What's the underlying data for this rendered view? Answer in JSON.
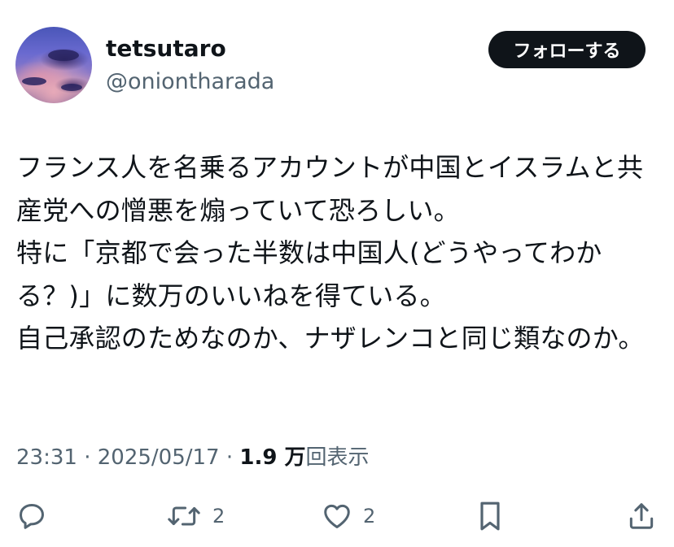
{
  "user": {
    "display_name": "tetsutaro",
    "handle": "@oniontharada"
  },
  "follow_button": {
    "label": "フォローする"
  },
  "tweet": {
    "text": "フランス人を名乗るアカウントが中国とイスラムと共産党への憎悪を煽っていて恐ろしい。\n特に「京都で会った半数は中国人(どうやってわかる？)」に数万のいいねを得ている。\n自己承認のためなのか、ナザレンコと同じ類なのか。"
  },
  "meta": {
    "time": "23:31",
    "separator": "·",
    "date": "2025/05/17",
    "views_count": "1.9 万",
    "views_label": "回表示"
  },
  "actions": {
    "reply": {
      "icon": "reply-icon",
      "count": ""
    },
    "retweet": {
      "icon": "retweet-icon",
      "count": "2"
    },
    "like": {
      "icon": "heart-icon",
      "count": "2"
    },
    "bookmark": {
      "icon": "bookmark-icon"
    },
    "share": {
      "icon": "share-icon"
    }
  },
  "colors": {
    "text": "#0f1419",
    "secondary": "#536471",
    "button_bg": "#0f1419",
    "button_text": "#ffffff"
  }
}
